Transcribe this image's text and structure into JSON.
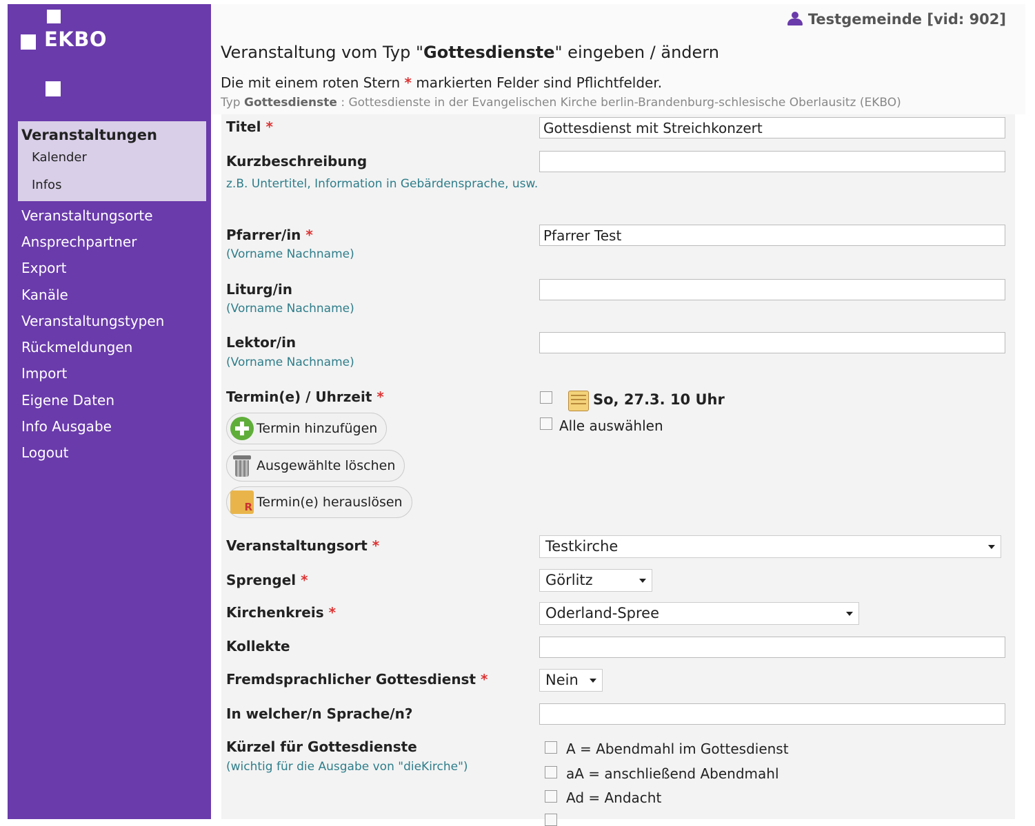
{
  "sidebar": {
    "logo": "EKBO",
    "active_section": "Veranstaltungen",
    "active_sub": [
      "Kalender",
      "Infos"
    ],
    "items": [
      "Veranstaltungsorte",
      "Ansprechpartner",
      "Export",
      "Kanäle",
      "Veranstaltungstypen",
      "Rückmeldungen",
      "Import",
      "Eigene Daten",
      "Info Ausgabe",
      "Logout"
    ]
  },
  "header": {
    "user": "Testgemeinde [vid: 902]",
    "heading_prefix": "Veranstaltung vom Typ \"",
    "heading_type": "Gottesdienste",
    "heading_suffix": "\" eingeben / ändern",
    "required_note_prefix": "Die mit einem roten Stern",
    "required_star": "*",
    "required_note_suffix": "markierten Felder sind Pflichtfelder.",
    "type_prefix": "Typ",
    "type_name": "Gottesdienste",
    "type_desc": ": Gottesdienste in der Evangelischen Kirche berlin-Brandenburg-schlesische Oberlausitz (EKBO)"
  },
  "form": {
    "titel_label": "Titel",
    "titel_value": "Gottesdienst mit Streichkonzert",
    "kurz_label": "Kurzbeschreibung",
    "kurz_hint": "z.B. Untertitel, Information in Gebärdensprache, usw.",
    "kurz_value": "",
    "pfarrer_label": "Pfarrer/in",
    "pfarrer_hint": "(Vorname Nachname)",
    "pfarrer_value": "Pfarrer Test",
    "liturg_label": "Liturg/in",
    "liturg_hint": "(Vorname Nachname)",
    "liturg_value": "",
    "lektor_label": "Lektor/in",
    "lektor_hint": "(Vorname Nachname)",
    "lektor_value": "",
    "termin_label": "Termin(e) / Uhrzeit",
    "termin_date": "So, 27.3. 10 Uhr",
    "select_all": "Alle auswählen",
    "btn_add": "Termin hinzufügen",
    "btn_delete": "Ausgewählte löschen",
    "btn_extract": "Termin(e) herauslösen",
    "ort_label": "Veranstaltungsort",
    "ort_value": "Testkirche",
    "sprengel_label": "Sprengel",
    "sprengel_value": "Görlitz",
    "kreis_label": "Kirchenkreis",
    "kreis_value": "Oderland-Spree",
    "kollekte_label": "Kollekte",
    "kollekte_value": "",
    "fremd_label": "Fremdsprachlicher Gottesdienst",
    "fremd_value": "Nein",
    "sprache_label": "In welcher/n Sprache/n?",
    "sprache_value": "",
    "kuerzel_label": "Kürzel für Gottesdienste",
    "kuerzel_hint": "(wichtig für die Ausgabe von \"dieKirche\")",
    "kuerzel": [
      "A = Abendmahl im Gottesdienst",
      "aA = anschließend Abendmahl",
      "Ad = Andacht"
    ],
    "star": "*"
  },
  "colors": {
    "sidebar": "#6a3bab",
    "active_nav": "#d9cfe8",
    "required": "#dd3333",
    "hint": "#2e7d8a"
  }
}
